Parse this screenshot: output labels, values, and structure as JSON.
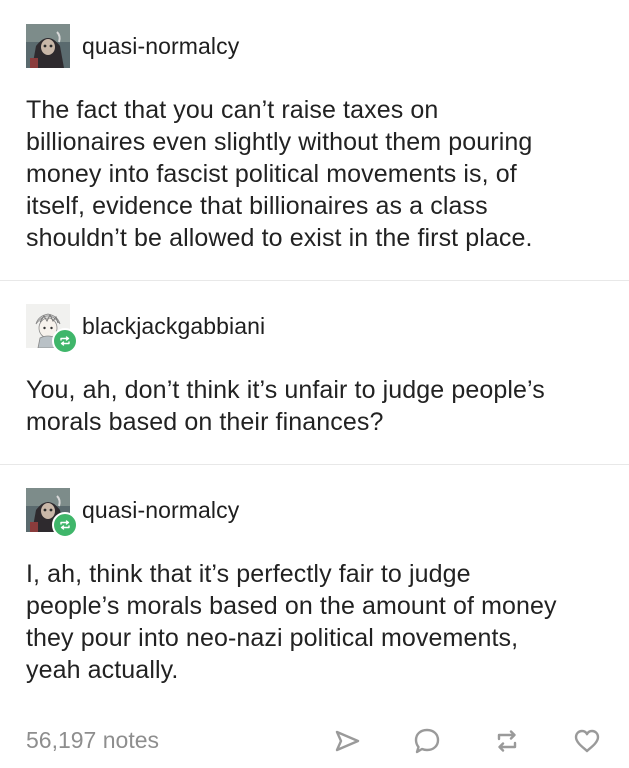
{
  "post": {
    "entries": [
      {
        "username": "quasi-normalcy",
        "reblog": false,
        "avatar_icon": "hooded-figure-avatar",
        "text": "The fact that you can’t raise taxes on\nbillionaires even slightly without them pouring\nmoney into fascist political movements is, of\nitself, evidence that billionaires as a class\nshouldn’t be allowed to exist in the first place."
      },
      {
        "username": "blackjackgabbiani",
        "reblog": true,
        "avatar_icon": "sketch-character-avatar",
        "text": "You, ah, don’t think it’s unfair to judge people’s\nmorals based on their finances?"
      },
      {
        "username": "quasi-normalcy",
        "reblog": true,
        "avatar_icon": "hooded-figure-avatar",
        "text": "I, ah, think that it’s perfectly fair to judge\npeople’s morals based on the amount of money\nthey pour into neo-nazi political movements,\nyeah actually."
      }
    ],
    "footer": {
      "notes": "56,197 notes",
      "actions": [
        "share-icon",
        "reply-icon",
        "reblog-icon",
        "like-icon"
      ]
    }
  },
  "colors": {
    "text": "#222222",
    "muted": "#8e8e8e",
    "icon": "#9a9a9a",
    "reblog_badge": "#3fb66a",
    "divider": "#e8e8e8"
  }
}
